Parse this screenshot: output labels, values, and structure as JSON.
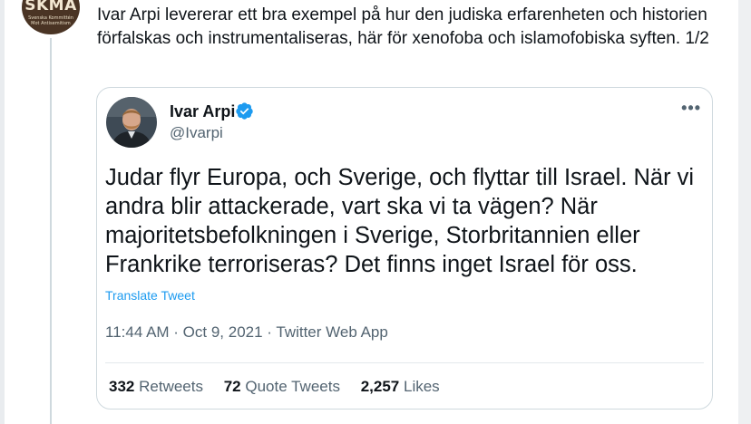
{
  "outer_post": {
    "avatar_text": "SKMA",
    "avatar_subtext": [
      "Svenska Kommittén",
      "Mot Antisemitism"
    ],
    "text": "Ivar Arpi levererar ett bra exempel på hur den judiska erfarenheten och historien förfalskas och instrumentaliseras, här för xenofoba och islamofobiska syften.  1/2"
  },
  "quoted_tweet": {
    "author_name": "Ivar Arpi",
    "handle": "@Ivarpi",
    "verified": true,
    "body": "Judar flyr Europa, och Sverige, och flyttar till Israel. När vi andra blir attackerade, vart ska vi ta vägen? När majoritetsbefolkningen i Sverige, Storbritannien eller Frankrike terroriseras? Det finns inget Israel för oss.",
    "translate_label": "Translate Tweet",
    "timestamp": "11:44 AM · Oct 9, 2021 · Twitter Web App",
    "stats": {
      "retweets_count": "332",
      "retweets_label": "Retweets",
      "quotes_count": "72",
      "quotes_label": "Quote Tweets",
      "likes_count": "2,257",
      "likes_label": "Likes"
    }
  },
  "colors": {
    "link": "#1d9bf0",
    "secondary_text": "#536471",
    "border": "#cfd9de",
    "skma_badge": "#4a3424"
  },
  "icons": [
    "more-icon",
    "verified-badge-icon"
  ]
}
